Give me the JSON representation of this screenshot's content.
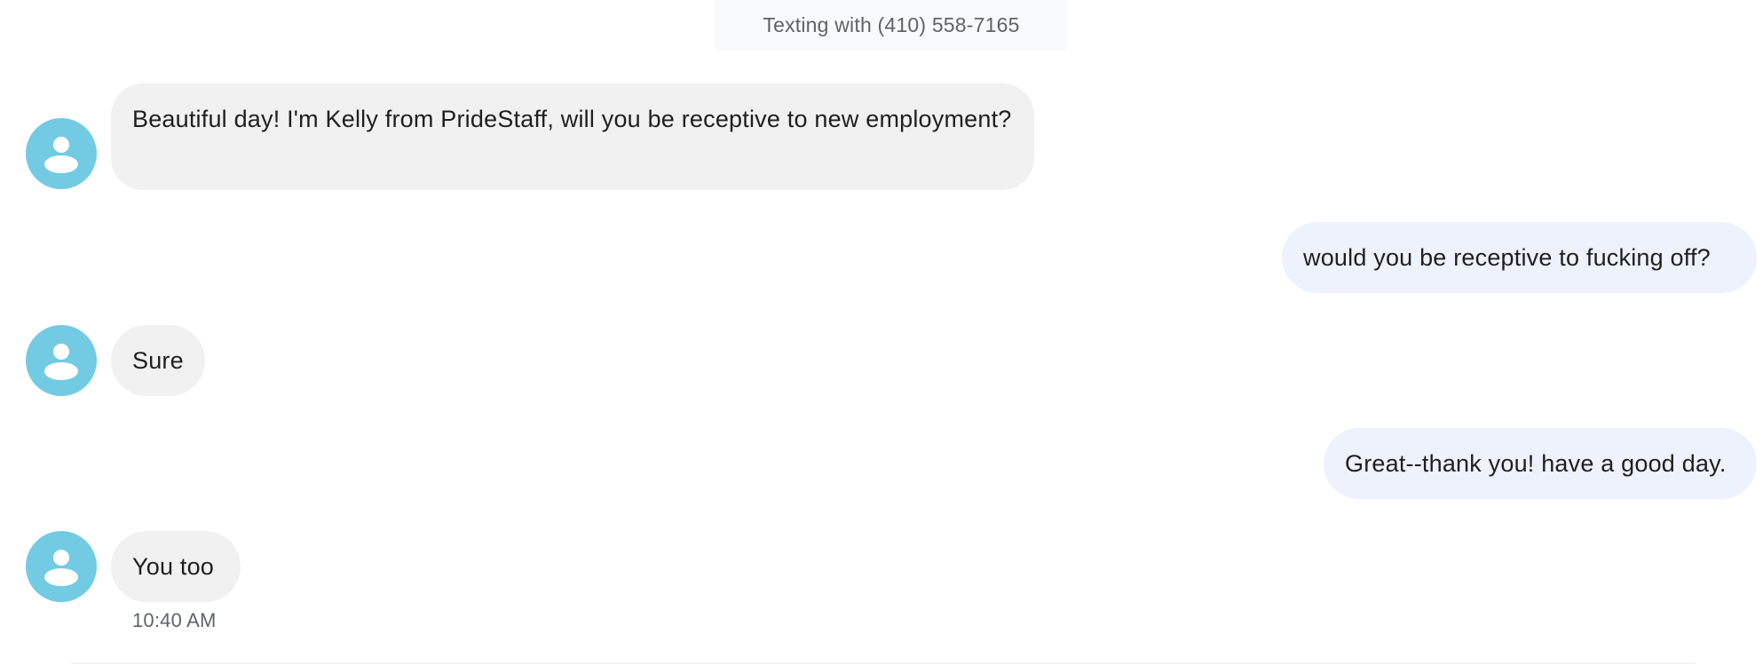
{
  "conversation": {
    "header": "Texting with (410) 558-7165",
    "messages": [
      {
        "direction": "incoming",
        "text": "Beautiful day! I'm Kelly from PrideStaff, will you be receptive to new employment?"
      },
      {
        "direction": "outgoing",
        "text": "would you be receptive to fucking off?"
      },
      {
        "direction": "incoming",
        "text": "Sure"
      },
      {
        "direction": "outgoing",
        "text": "Great--thank you! have a good day."
      },
      {
        "direction": "incoming",
        "text": "You too"
      }
    ],
    "last_timestamp": "10:40 AM"
  },
  "colors": {
    "avatar": "#72cbe3",
    "incoming_bubble": "#f1f1f1",
    "outgoing_bubble": "#edf2fc",
    "header_chip": "#f8f9fa",
    "meta_text": "#5f6368"
  },
  "icons": {
    "avatar": "person-icon"
  }
}
